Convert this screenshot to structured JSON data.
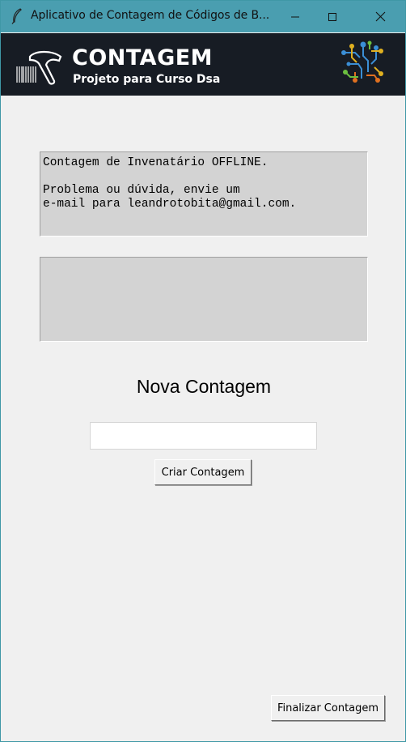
{
  "window": {
    "title": "Aplicativo de Contagem de Códigos de B...",
    "minimize_icon": "minimize-icon",
    "maximize_icon": "maximize-icon",
    "close_icon": "close-icon",
    "app_icon": "feather-icon"
  },
  "banner": {
    "title": "CONTAGEM",
    "subtitle": "Projeto para Curso Dsa",
    "logo_icon": "barcode-scanner-icon",
    "circuit_icon": "circuit-icon"
  },
  "info_box": {
    "text": "Contagem de Invenatário OFFLINE.\n\nProblema ou dúvida, envie um\ne-mail para leandrotobita@gmail.com."
  },
  "output_box": {
    "text": ""
  },
  "nova_contagem": {
    "heading": "Nova Contagem",
    "input_value": "",
    "create_button": "Criar Contagem"
  },
  "footer": {
    "finish_button": "Finalizar Contagem"
  },
  "colors": {
    "titlebar": "#4a9eb0",
    "banner": "#171c24",
    "textbox": "#d3d3d3",
    "background": "#f0f0f0"
  }
}
